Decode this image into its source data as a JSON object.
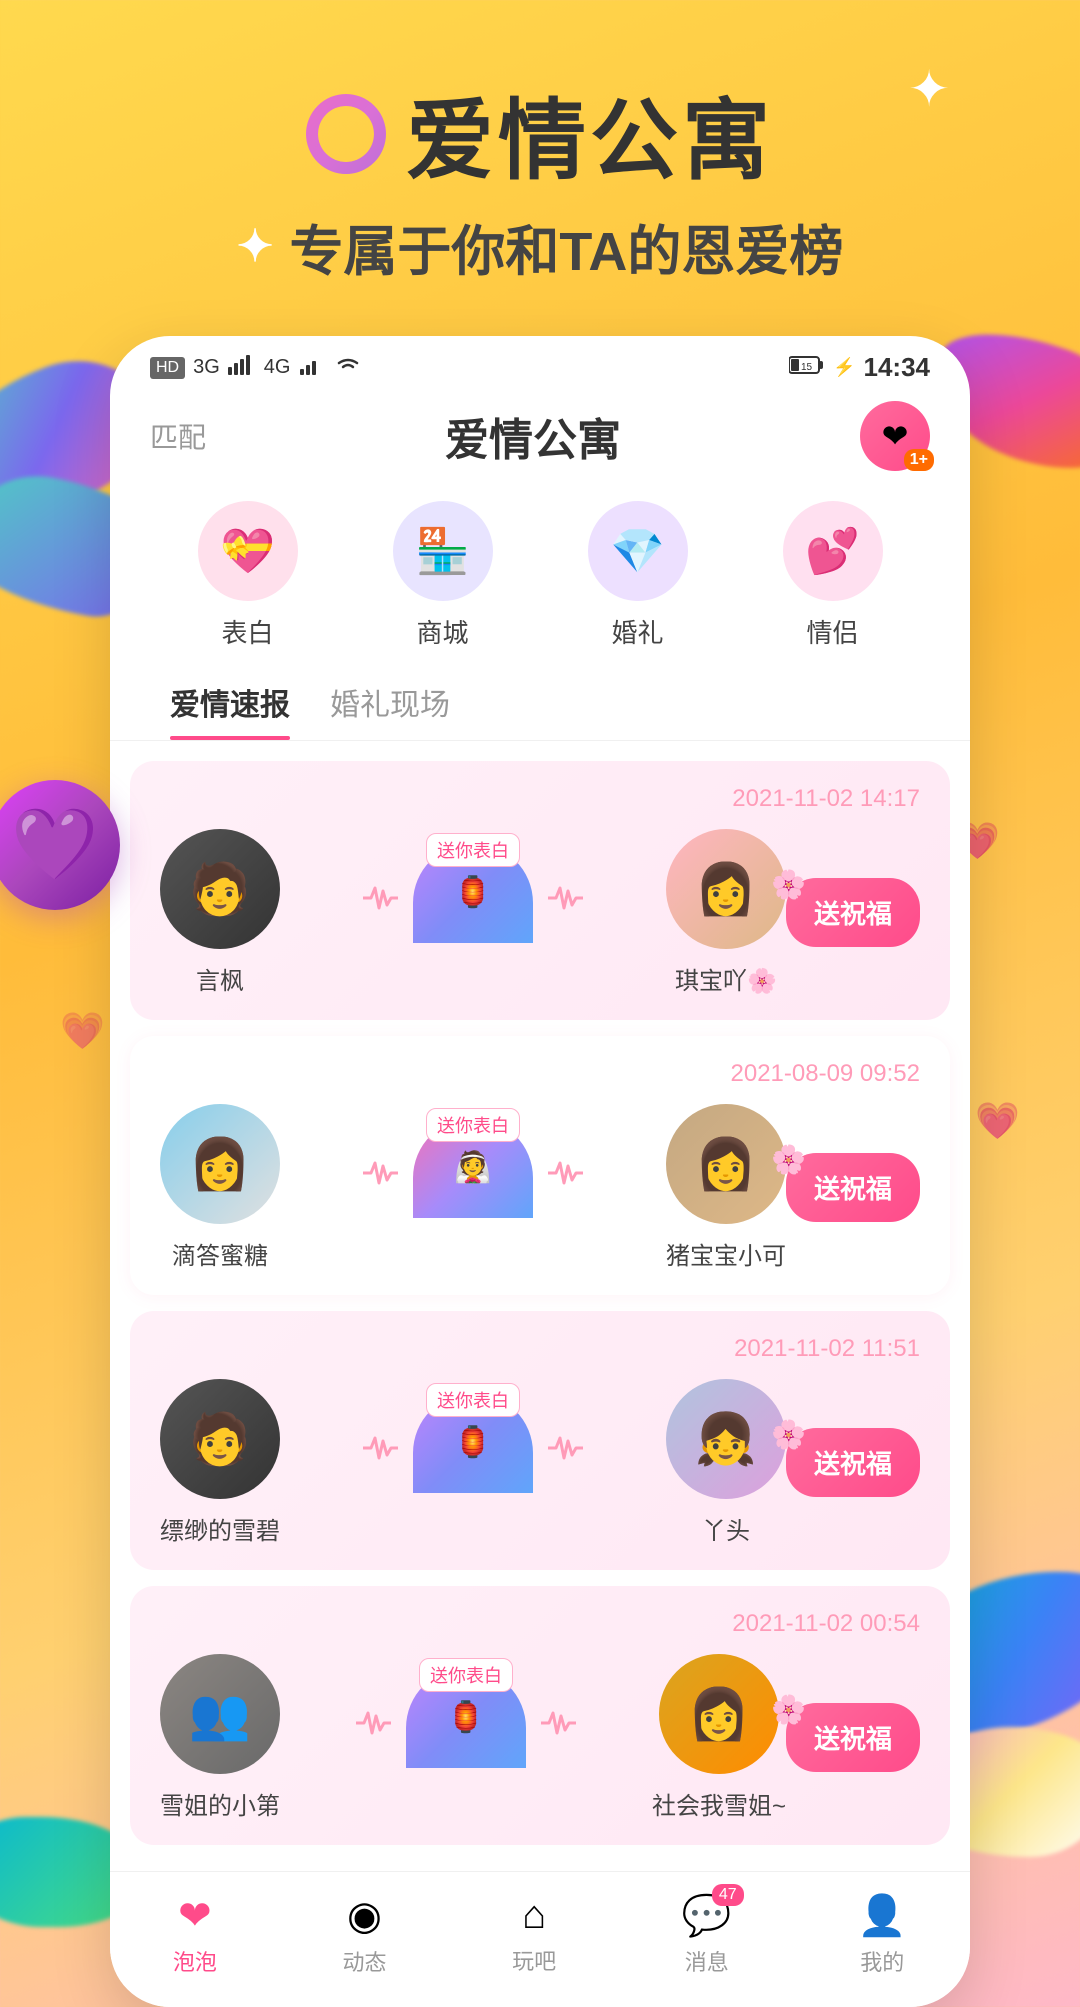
{
  "header": {
    "ring_icon": "○",
    "title": "爱情公寓",
    "subtitle": "专属于你和TA的恩爱榜",
    "sparkle": "✦"
  },
  "status_bar": {
    "hd": "HD",
    "network": "3G 4G",
    "time": "14:34",
    "battery": "15"
  },
  "app_header": {
    "match_label": "匹配",
    "title": "爱情公寓",
    "heart_icon": "❤",
    "badge_num": "1+"
  },
  "quick_icons": [
    {
      "label": "表白",
      "emoji": "💝",
      "bg": "icon-red"
    },
    {
      "label": "商城",
      "emoji": "🏪",
      "bg": "icon-blue"
    },
    {
      "label": "婚礼",
      "emoji": "💎",
      "bg": "icon-purple"
    },
    {
      "label": "情侣",
      "emoji": "💕",
      "bg": "icon-pink"
    }
  ],
  "tabs": [
    {
      "label": "爱情速报",
      "active": true
    },
    {
      "label": "婚礼现场",
      "active": false
    }
  ],
  "couples": [
    {
      "time": "2021-11-02 14:17",
      "person1": {
        "name": "言枫",
        "avatar_type": "avatar-dark",
        "emoji": "👤"
      },
      "person2": {
        "name": "琪宝吖🌸",
        "avatar_type": "avatar-girl",
        "emoji": "👤"
      },
      "blessing_label": "送祝福",
      "tag": "送你表白"
    },
    {
      "time": "2021-08-09 09:52",
      "person1": {
        "name": "滴答蜜糖",
        "avatar_type": "avatar-girl",
        "emoji": "👩"
      },
      "person2": {
        "name": "猪宝宝小可",
        "avatar_type": "avatar-girl",
        "emoji": "👩"
      },
      "blessing_label": "送祝福",
      "tag": "送你表白"
    },
    {
      "time": "2021-11-02 11:51",
      "person1": {
        "name": "缥缈的雪碧",
        "avatar_type": "avatar-suit",
        "emoji": "🧑"
      },
      "person2": {
        "name": "丫头",
        "avatar_type": "avatar-anime",
        "emoji": "👧"
      },
      "blessing_label": "送祝福",
      "tag": "送你表白"
    },
    {
      "time": "2021-11-02 00:54",
      "person1": {
        "name": "雪姐的小第",
        "avatar_type": "avatar-crowd",
        "emoji": "👥"
      },
      "person2": {
        "name": "社会我雪姐~",
        "avatar_type": "avatar-yellow",
        "emoji": "👩"
      },
      "blessing_label": "送祝福",
      "tag": "送你表白"
    }
  ],
  "bottom_nav": [
    {
      "label": "泡泡",
      "emoji": "❤",
      "active": true
    },
    {
      "label": "动态",
      "emoji": "◉",
      "active": false
    },
    {
      "label": "玩吧",
      "emoji": "⌂",
      "active": false
    },
    {
      "label": "消息",
      "emoji": "💬",
      "active": false,
      "badge": "47"
    },
    {
      "label": "我的",
      "emoji": "👤",
      "active": false
    }
  ]
}
